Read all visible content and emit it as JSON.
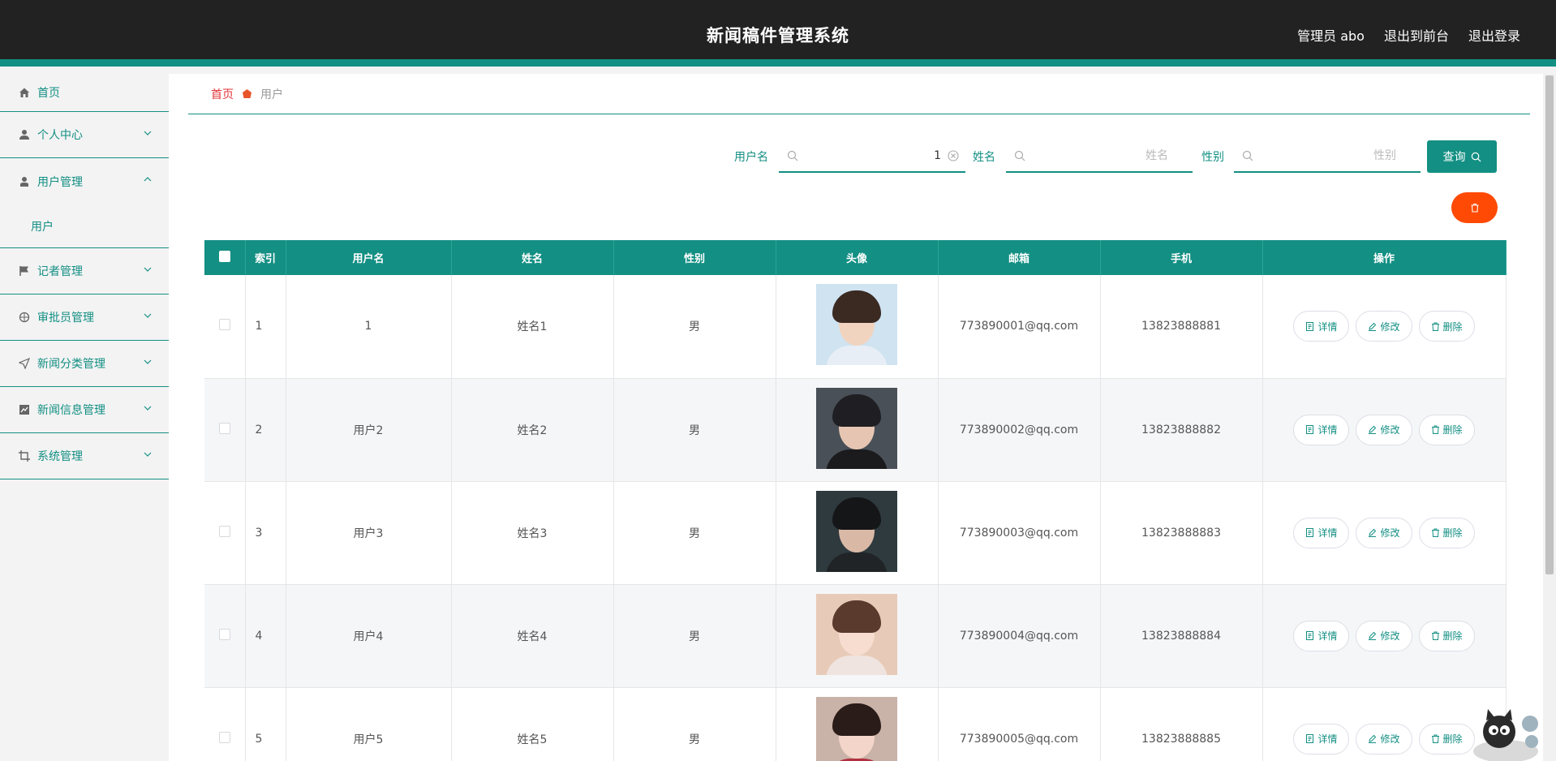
{
  "header": {
    "title": "新闻稿件管理系统",
    "admin_label": "管理员 abo",
    "exit_front": "退出到前台",
    "logout": "退出登录"
  },
  "sidebar": {
    "items": [
      {
        "label": "首页",
        "icon": "home-icon"
      },
      {
        "label": "个人中心",
        "icon": "person-icon"
      },
      {
        "label": "用户管理",
        "icon": "user-icon",
        "expanded": true,
        "children": [
          {
            "label": "用户"
          }
        ]
      },
      {
        "label": "记者管理",
        "icon": "flag-icon"
      },
      {
        "label": "审批员管理",
        "icon": "compass-icon"
      },
      {
        "label": "新闻分类管理",
        "icon": "send-icon"
      },
      {
        "label": "新闻信息管理",
        "icon": "chart-icon"
      },
      {
        "label": "系统管理",
        "icon": "crop-icon"
      }
    ]
  },
  "breadcrumb": {
    "home": "首页",
    "current": "用户"
  },
  "search": {
    "username_label": "用户名",
    "username_value": "1",
    "name_label": "姓名",
    "name_placeholder": "姓名",
    "gender_label": "性别",
    "gender_placeholder": "性别",
    "query_button": "查询"
  },
  "colors": {
    "accent": "#138f83",
    "header_bg": "#222222",
    "danger": "#ff4a05",
    "home_link": "#e0353a"
  },
  "table": {
    "columns": [
      "索引",
      "用户名",
      "姓名",
      "性别",
      "头像",
      "邮箱",
      "手机",
      "操作"
    ],
    "rows": [
      {
        "index": "1",
        "username": "1",
        "name": "姓名1",
        "gender": "男",
        "email": "773890001@qq.com",
        "phone": "13823888881"
      },
      {
        "index": "2",
        "username": "用户2",
        "name": "姓名2",
        "gender": "男",
        "email": "773890002@qq.com",
        "phone": "13823888882"
      },
      {
        "index": "3",
        "username": "用户3",
        "name": "姓名3",
        "gender": "男",
        "email": "773890003@qq.com",
        "phone": "13823888883"
      },
      {
        "index": "4",
        "username": "用户4",
        "name": "姓名4",
        "gender": "男",
        "email": "773890004@qq.com",
        "phone": "13823888884"
      },
      {
        "index": "5",
        "username": "用户5",
        "name": "姓名5",
        "gender": "男",
        "email": "773890005@qq.com",
        "phone": "13823888885"
      }
    ],
    "actions": {
      "detail": "详情",
      "edit": "修改",
      "delete": "删除"
    }
  }
}
